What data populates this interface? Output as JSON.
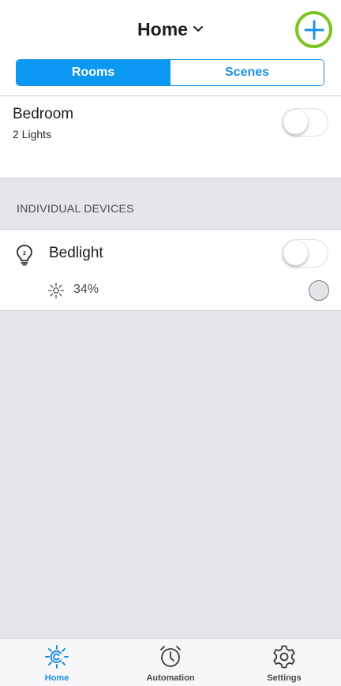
{
  "header": {
    "title": "Home",
    "add_icon": "plus-icon",
    "chevron_icon": "chevron-down-icon"
  },
  "segments": [
    {
      "label": "Rooms",
      "selected": true
    },
    {
      "label": "Scenes",
      "selected": false
    }
  ],
  "rooms": [
    {
      "name": "Bedroom",
      "subtitle": "2 Lights",
      "on": false
    }
  ],
  "individual_devices": {
    "section_label": "INDIVIDUAL DEVICES",
    "devices": [
      {
        "name": "Bedlight",
        "brightness": "34%",
        "on": false,
        "icon": "bulb-icon",
        "brightness_icon": "brightness-icon"
      }
    ]
  },
  "tabbar": {
    "tabs": [
      {
        "label": "Home",
        "icon": "home-logo-icon",
        "active": true
      },
      {
        "label": "Automation",
        "icon": "alarm-clock-icon",
        "active": false
      },
      {
        "label": "Settings",
        "icon": "gear-icon",
        "active": false
      }
    ]
  },
  "colors": {
    "accent_blue": "#0a98f2",
    "add_ring_green": "#7cc41f",
    "background_gray": "#e6e6ea"
  }
}
